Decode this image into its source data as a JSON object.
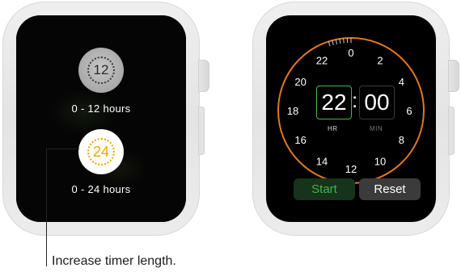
{
  "left_watch": {
    "options": [
      {
        "dial_number": "12",
        "label": "0 - 12 hours",
        "selected": false
      },
      {
        "dial_number": "24",
        "label": "0 - 24 hours",
        "selected": true
      }
    ]
  },
  "right_watch": {
    "dial_numbers": [
      "0",
      "2",
      "4",
      "6",
      "8",
      "10",
      "12",
      "14",
      "16",
      "18",
      "20",
      "22"
    ],
    "hours": "22",
    "minutes": "00",
    "separator": ":",
    "hours_unit": "HR",
    "minutes_unit": "MIN",
    "start_label": "Start",
    "reset_label": "Reset"
  },
  "callout": {
    "text": "Increase timer length."
  },
  "colors": {
    "accent_orange": "#f0a500",
    "accent_green": "#43b64a",
    "dial_ring": "#e0781f"
  }
}
